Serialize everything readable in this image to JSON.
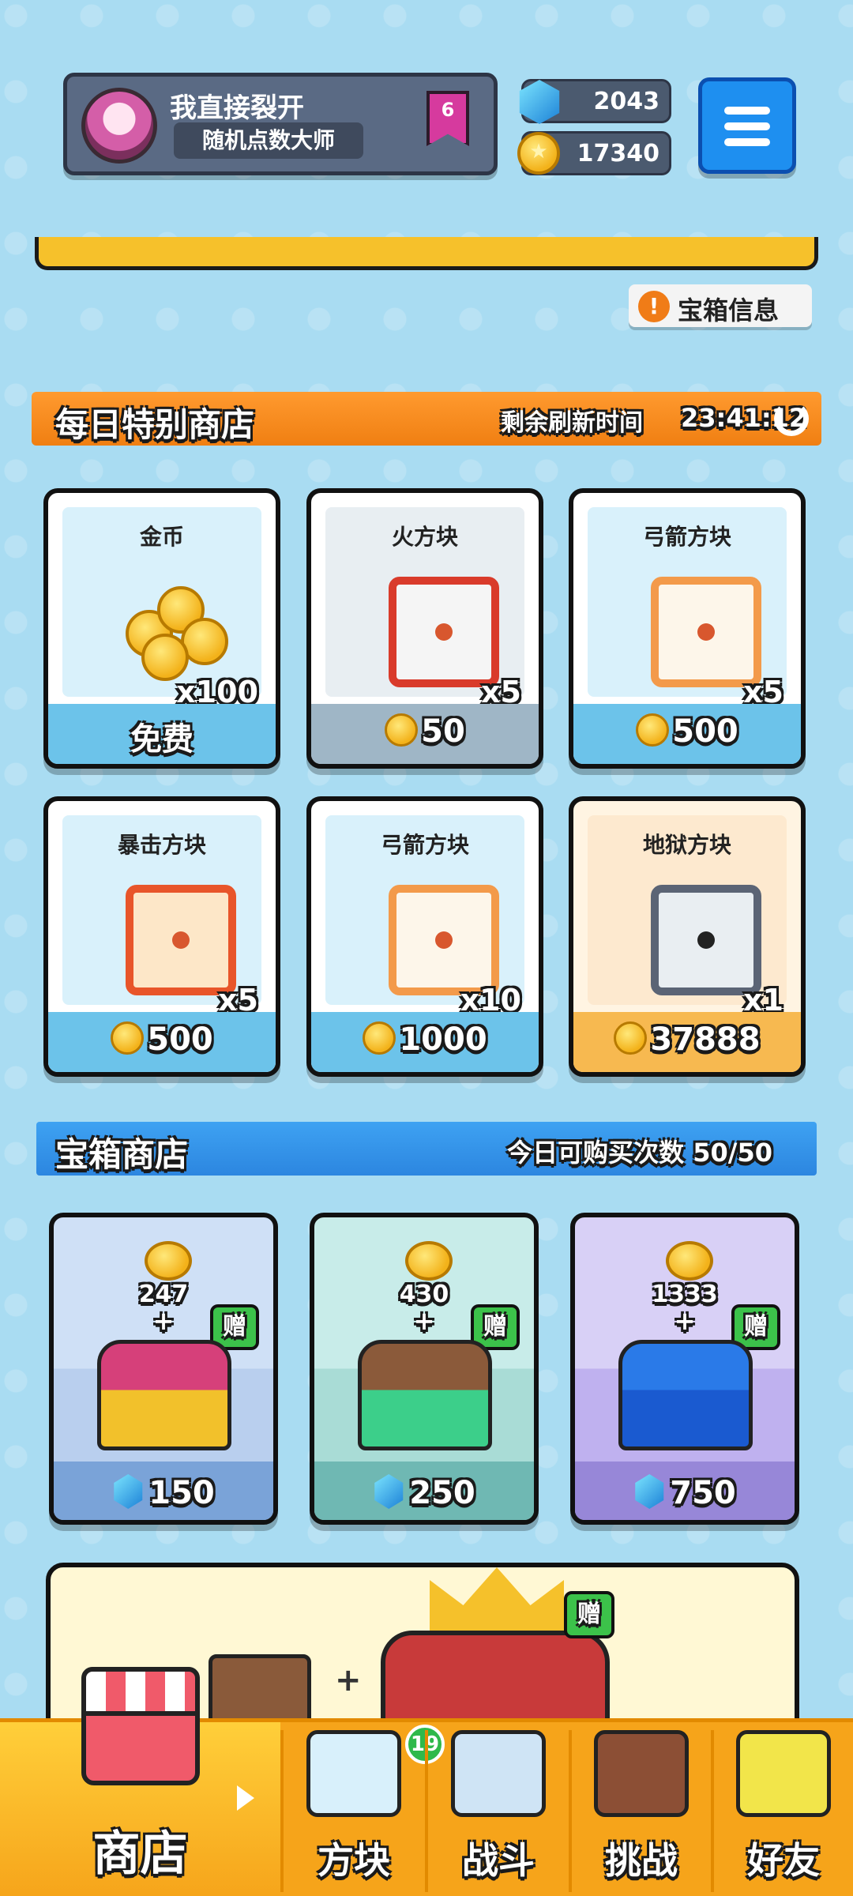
{
  "header": {
    "player_name": "我直接裂开",
    "player_title": "随机点数大师",
    "rank": "6",
    "gems": "2043",
    "coins": "17340"
  },
  "chest_info_label": "宝箱信息",
  "daily_shop": {
    "title": "每日特别商店",
    "refresh_label": "剩余刷新时间",
    "refresh_time": "23:41:12",
    "items": [
      {
        "name": "金币",
        "qty": "x100",
        "price": "免费",
        "price_has_coin": false
      },
      {
        "name": "火方块",
        "qty": "x5",
        "price": "50",
        "price_has_coin": true
      },
      {
        "name": "弓箭方块",
        "qty": "x5",
        "price": "500",
        "price_has_coin": true
      },
      {
        "name": "暴击方块",
        "qty": "x5",
        "price": "500",
        "price_has_coin": true
      },
      {
        "name": "弓箭方块",
        "qty": "x10",
        "price": "1000",
        "price_has_coin": true
      },
      {
        "name": "地狱方块",
        "qty": "x1",
        "price": "37888",
        "price_has_coin": true
      }
    ]
  },
  "chest_shop": {
    "title": "宝箱商店",
    "count_label": "今日可购买次数 50/50",
    "gift_label": "赠",
    "plus": "+",
    "chests": [
      {
        "coins": "247",
        "price": "150"
      },
      {
        "coins": "430",
        "price": "250"
      },
      {
        "coins": "1333",
        "price": "750"
      }
    ]
  },
  "big_chest": {
    "gift_label": "赠",
    "plus": "+"
  },
  "bottom_nav": {
    "shop": "商店",
    "blocks": "方块",
    "blocks_badge": "19",
    "battle": "战斗",
    "challenge": "挑战",
    "friends": "好友"
  },
  "colors": {
    "background": "#a9dcf2",
    "daily_header": "#f07f12",
    "chest_header": "#2c86e0",
    "nav": "#f6a41a"
  }
}
